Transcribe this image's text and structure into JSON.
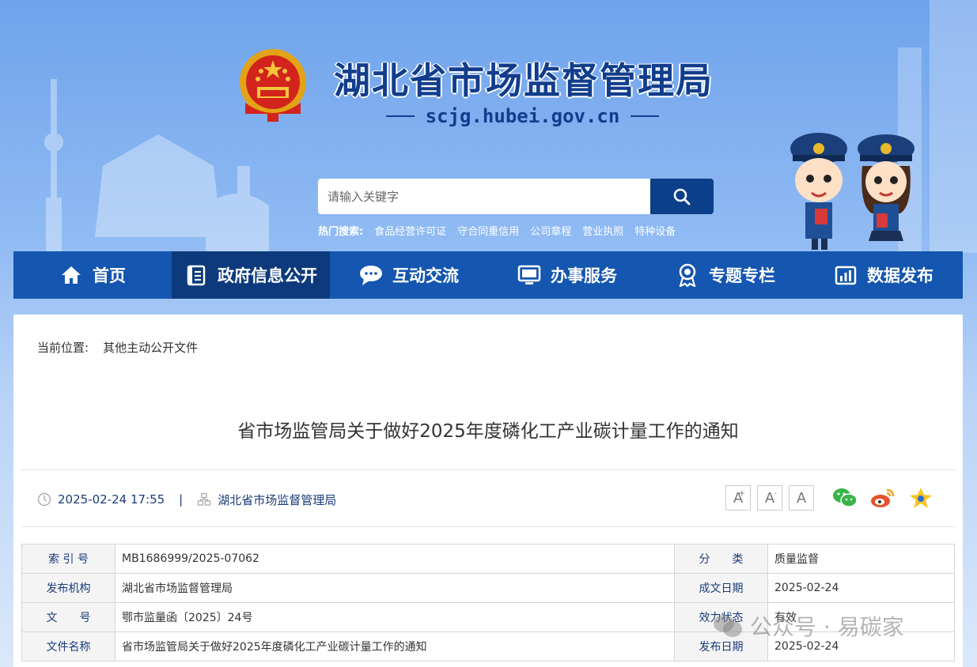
{
  "header": {
    "title": "湖北省市场监督管理局",
    "domain": "scjg.hubei.gov.cn"
  },
  "search": {
    "placeholder": "请输入关键字",
    "hot_label": "热门搜索:",
    "hot_links": [
      "食品经营许可证",
      "守合同重信用",
      "公司章程",
      "营业执照",
      "特种设备"
    ]
  },
  "nav": {
    "items": [
      {
        "label": "首页",
        "icon": "home-icon"
      },
      {
        "label": "政府信息公开",
        "icon": "document-icon",
        "active": true
      },
      {
        "label": "互动交流",
        "icon": "chat-bubble-icon"
      },
      {
        "label": "办事服务",
        "icon": "monitor-icon"
      },
      {
        "label": "专题专栏",
        "icon": "award-icon"
      },
      {
        "label": "数据发布",
        "icon": "bar-chart-icon"
      }
    ]
  },
  "breadcrumb": {
    "label": "当前位置:",
    "current": "其他主动公开文件"
  },
  "article": {
    "title": "省市场监管局关于做好2025年度磷化工产业碳计量工作的通知",
    "datetime": "2025-02-24 17:55",
    "separator": "|",
    "publisher": "湖北省市场监督管理局"
  },
  "font_buttons": [
    "A",
    "A",
    "A"
  ],
  "font_button_marks": [
    "+",
    "-",
    ""
  ],
  "share": [
    "wechat-icon",
    "weibo-icon",
    "favorite-star-icon"
  ],
  "info_table": {
    "rows": [
      {
        "l1": "索 引 号",
        "v1": "MB1686999/2025-07062",
        "l2": "分　　类",
        "v2": "质量监督"
      },
      {
        "l1": "发布机构",
        "v1": "湖北省市场监督管理局",
        "l2": "成文日期",
        "v2": "2025-02-24"
      },
      {
        "l1": "文　　号",
        "v1": "鄂市监量函〔2025〕24号",
        "l2": "效力状态",
        "v2": "有效"
      },
      {
        "l1": "文件名称",
        "v1": "省市场监管局关于做好2025年度磷化工产业碳计量工作的通知",
        "l2": "发布日期",
        "v2": "2025-02-24"
      }
    ]
  },
  "watermark": "公众号 · 易碳家",
  "colors": {
    "nav_bg": "#1456b0",
    "nav_active": "#0c3a7c",
    "title_blue": "#123d8c",
    "search_btn": "#0c3f8a"
  }
}
